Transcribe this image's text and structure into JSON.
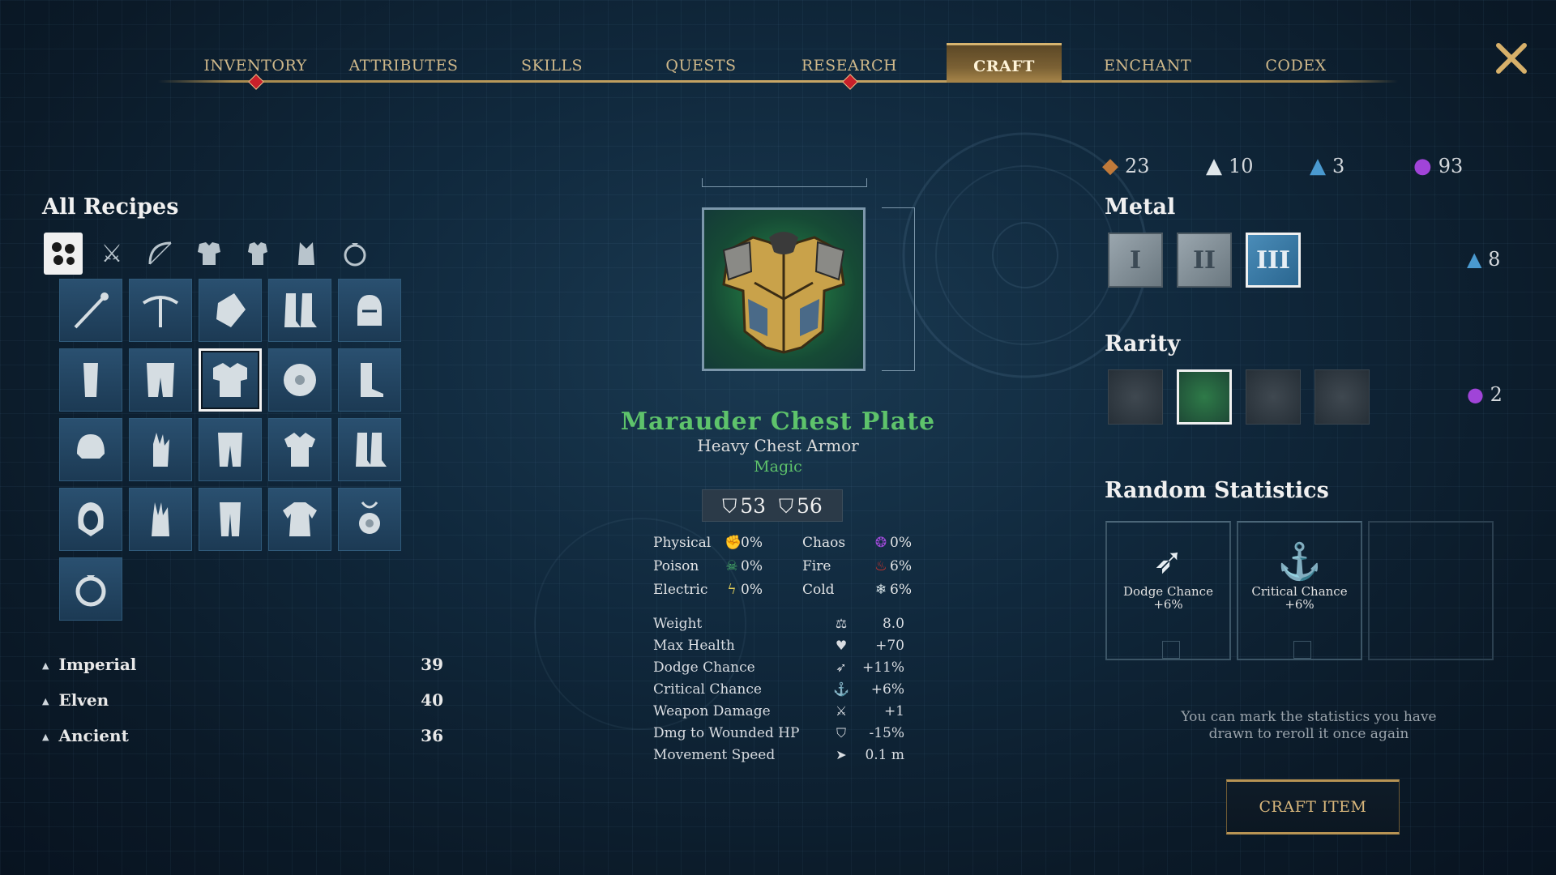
{
  "nav": {
    "tabs": [
      "INVENTORY",
      "ATTRIBUTES",
      "SKILLS",
      "QUESTS",
      "RESEARCH",
      "CRAFT",
      "ENCHANT",
      "CODEX"
    ],
    "active_tab": "CRAFT"
  },
  "left": {
    "title": "All Recipes",
    "categories": [
      "all-icon",
      "swords-icon",
      "bow-icon",
      "heavy-armor-icon",
      "medium-armor-icon",
      "light-armor-icon",
      "ring-icon"
    ],
    "recipes": [
      "staff",
      "crossbow",
      "gauntlet",
      "boots",
      "helmet",
      "bracer",
      "leggings",
      "chest-plate",
      "shield",
      "boots",
      "helmet",
      "glove",
      "pants",
      "vest",
      "boots",
      "hood",
      "glove",
      "pants",
      "robe",
      "amulet",
      "ring"
    ],
    "groups": [
      {
        "name": "Imperial",
        "count": "39"
      },
      {
        "name": "Elven",
        "count": "40"
      },
      {
        "name": "Ancient",
        "count": "36"
      }
    ]
  },
  "item": {
    "name": "Marauder Chest Plate",
    "type": "Heavy Chest Armor",
    "rarity": "Magic",
    "armor_a": "53",
    "armor_b": "56",
    "resistances": [
      {
        "label": "Physical",
        "value": "0%",
        "icon": "physical-icon",
        "color": "#d8e4e8"
      },
      {
        "label": "Chaos",
        "value": "0%",
        "icon": "chaos-icon",
        "color": "#a04ad8"
      },
      {
        "label": "Poison",
        "value": "0%",
        "icon": "poison-icon",
        "color": "#4cb86a"
      },
      {
        "label": "Fire",
        "value": "6%",
        "icon": "fire-icon",
        "color": "#e0352b"
      },
      {
        "label": "Electric",
        "value": "0%",
        "icon": "electric-icon",
        "color": "#e8d35a"
      },
      {
        "label": "Cold",
        "value": "6%",
        "icon": "cold-icon",
        "color": "#d8e4e8"
      }
    ],
    "stats": [
      {
        "label": "Weight",
        "value": "8.0",
        "icon": "weight-icon"
      },
      {
        "label": "Max Health",
        "value": "+70",
        "icon": "heart-icon"
      },
      {
        "label": "Dodge Chance",
        "value": "+11%",
        "icon": "dodge-icon"
      },
      {
        "label": "Critical Chance",
        "value": "+6%",
        "icon": "critical-icon"
      },
      {
        "label": "Weapon Damage",
        "value": "+1",
        "icon": "weapon-damage-icon"
      },
      {
        "label": "Dmg to Wounded HP",
        "value": "-15%",
        "icon": "shield-icon"
      },
      {
        "label": "Movement Speed",
        "value": "0.1 m",
        "icon": "speed-icon"
      }
    ]
  },
  "right": {
    "currencies": [
      {
        "icon": "ore-icon",
        "value": "23",
        "color": "#c07a3a"
      },
      {
        "icon": "crystal-white-icon",
        "value": "10",
        "color": "#dfe6ea"
      },
      {
        "icon": "crystal-blue-icon",
        "value": "3",
        "color": "#4a9ad0"
      },
      {
        "icon": "essence-purple-icon",
        "value": "93",
        "color": "#a044d8"
      }
    ],
    "metal_title": "Metal",
    "metal_tiers": [
      "I",
      "II",
      "III"
    ],
    "metal_active": 2,
    "metal_cost": "8",
    "rarity_title": "Rarity",
    "rarity_cost": "2",
    "random_title": "Random Statistics",
    "random_stats": [
      {
        "name": "Dodge Chance",
        "value": "+6%",
        "icon": "dodge-icon"
      },
      {
        "name": "Critical Chance",
        "value": "+6%",
        "icon": "critical-icon"
      }
    ],
    "note": "You can mark the statistics you have drawn to reroll it once again",
    "craft_label": "CRAFT ITEM"
  }
}
